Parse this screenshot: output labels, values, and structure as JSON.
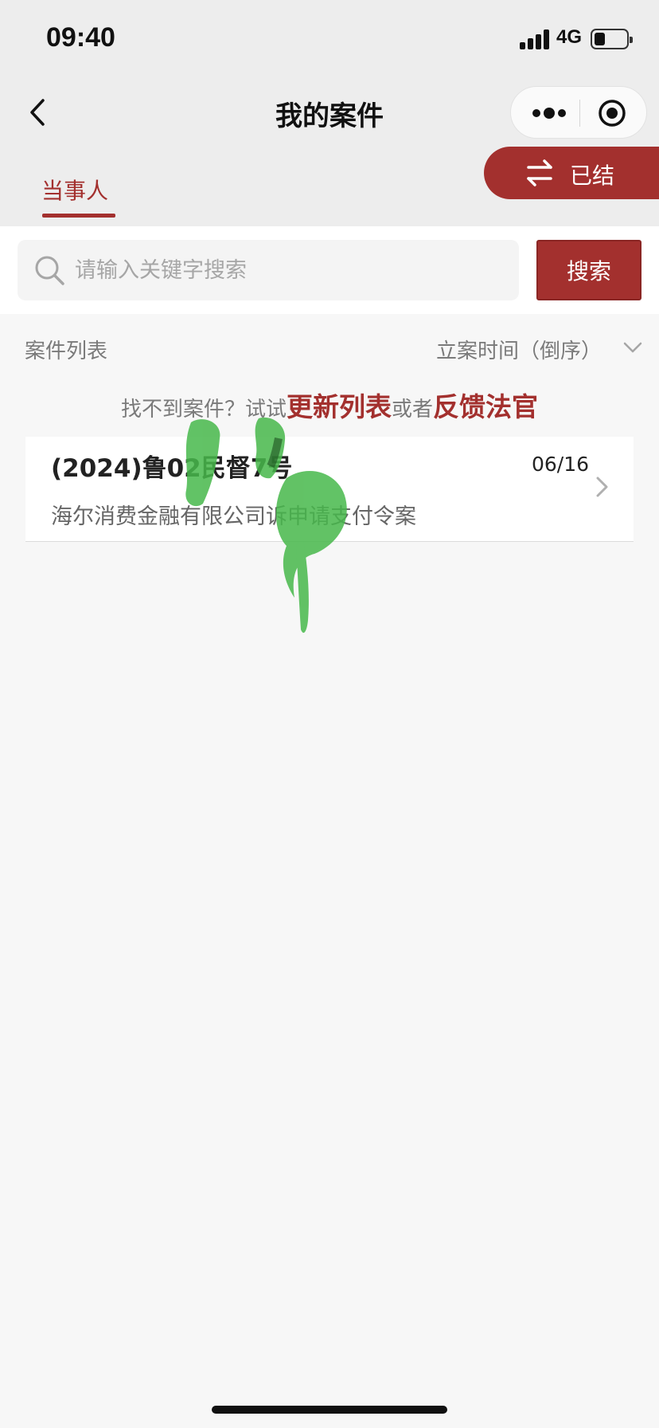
{
  "status_bar": {
    "time": "09:40",
    "network": "4G",
    "icons": [
      "signal-icon",
      "battery-icon"
    ]
  },
  "nav": {
    "title": "我的案件",
    "icons": [
      "back-icon",
      "more-icon",
      "target-icon"
    ]
  },
  "tabs": {
    "active_label": "当事人"
  },
  "concluded": {
    "label": "已结",
    "icon": "swap-icon"
  },
  "search": {
    "placeholder": "请输入关键字搜索",
    "button_label": "搜索",
    "icon": "search-icon"
  },
  "list": {
    "title": "案件列表",
    "sort_label": "立案时间（倒序）",
    "sort_icon": "chevron-down-icon"
  },
  "hint": {
    "prefix": "找不到案件？试试",
    "refresh_link": "更新列表",
    "middle": "或者",
    "feedback_link": "反馈法官"
  },
  "cases": [
    {
      "number": "(2024)鲁02民督7号",
      "date": "06/16",
      "description": "海尔消费金融有限公司诉申请支付令案"
    }
  ],
  "colors": {
    "brand": "#a3302e",
    "background": "#f7f7f7",
    "top_bar": "#ededed"
  }
}
